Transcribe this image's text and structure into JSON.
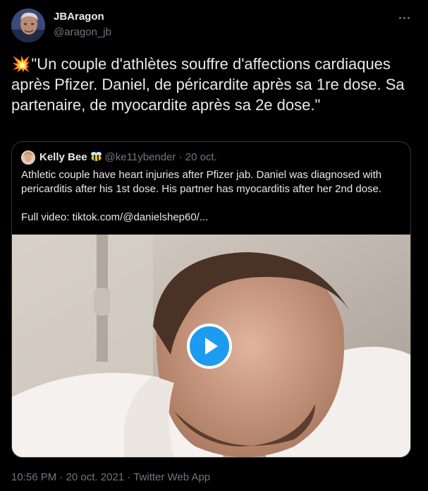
{
  "tweet": {
    "author": {
      "display_name": "JBAragon",
      "handle": "@aragon_jb",
      "avatar": "profile-photo"
    },
    "emoji": "💥",
    "text": "\"Un couple d'athlètes souffre d'affections cardiaques après Pfizer. Daniel, de péricardite après sa 1re dose. Sa partenaire, de myocardite après sa 2e dose.\"",
    "more_icon": "more-horizontal-icon",
    "timestamp": "10:56 PM",
    "separator": " · ",
    "date": "20 oct. 2021",
    "source": "Twitter Web App"
  },
  "quoted_tweet": {
    "author": {
      "display_name": "Kelly Bee",
      "badge_icon": "bee-emoji-icon",
      "handle": "@ke11ybender",
      "separator": "·",
      "date": "20 oct."
    },
    "text": "Athletic couple have heart injuries after Pfizer jab. Daniel was diagnosed with pericarditis after his 1st dose. His partner has myocarditis after her 2nd dose.",
    "link_line": "Full video: tiktok.com/@danielshep60/...",
    "media": {
      "type": "video",
      "play_icon": "play-icon"
    }
  },
  "colors": {
    "background": "#000000",
    "text_primary": "#e7e9ea",
    "text_secondary": "#71767b",
    "border": "#333639",
    "accent": "#1d9bf0"
  }
}
